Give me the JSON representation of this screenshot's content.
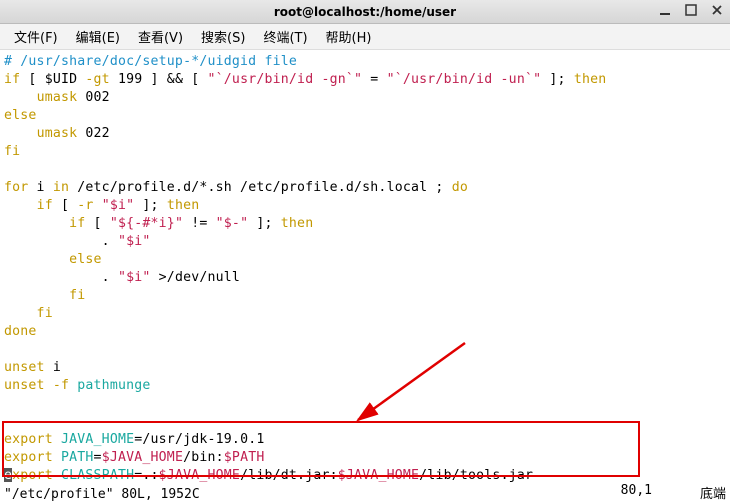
{
  "window": {
    "title": "root@localhost:/home/user"
  },
  "menu": {
    "file": "文件(F)",
    "edit": "编辑(E)",
    "view": "查看(V)",
    "search": "搜索(S)",
    "terminal": "终端(T)",
    "help": "帮助(H)"
  },
  "code": {
    "l1": "# /usr/share/doc/setup-*/uidgid file",
    "l2a": "if",
    "l2b": " [ $UID ",
    "l2c": "-gt",
    "l2d": " 199 ] && [ ",
    "l2e": "\"`/usr/bin/id -gn`\"",
    "l2f": " = ",
    "l2g": "\"`/usr/bin/id -un`\"",
    "l2h": " ]; ",
    "l2i": "then",
    "l3a": "    ",
    "l3b": "umask",
    "l3c": " 002",
    "l4": "else",
    "l5a": "    ",
    "l5b": "umask",
    "l5c": " 022",
    "l6": "fi",
    "l8a": "for",
    "l8b": " i ",
    "l8c": "in",
    "l8d": " /etc/profile.d/*.sh /etc/profile.d/sh.local ; ",
    "l8e": "do",
    "l9a": "    ",
    "l9b": "if",
    "l9c": " [ ",
    "l9d": "-r",
    "l9e": " ",
    "l9f": "\"$i\"",
    "l9g": " ]; ",
    "l9h": "then",
    "l10a": "        ",
    "l10b": "if",
    "l10c": " [ ",
    "l10d": "\"${-#*i}\"",
    "l10e": " != ",
    "l10f": "\"$-\"",
    "l10g": " ]; ",
    "l10h": "then",
    "l11a": "            . ",
    "l11b": "\"$i\"",
    "l12": "        else",
    "l13a": "            . ",
    "l13b": "\"$i\"",
    "l13c": " >/dev/null",
    "l14": "        fi",
    "l15": "    fi",
    "l16": "done",
    "l18a": "unset",
    "l18b": " i",
    "l19a": "unset",
    "l19b": " ",
    "l19c": "-f",
    "l19d": " pathmunge",
    "l21a": "export",
    "l21b": " ",
    "l21c": "JAVA_HOME",
    "l21d": "=/usr/jdk-19.0.1",
    "l22a": "export",
    "l22b": " ",
    "l22c": "PATH",
    "l22d": "=",
    "l22e": "$JAVA_HOME",
    "l22f": "/bin:",
    "l22g": "$PATH",
    "l23cur": "e",
    "l23a": "xport",
    "l23b": " ",
    "l23c": "CLASSPATH",
    "l23d": "=.:",
    "l23e": "$JAVA_HOME",
    "l23f": "/lib/dt.jar:",
    "l23g": "$JAVA_HOME",
    "l23h": "/lib/tools.jar"
  },
  "status": {
    "left": "\"/etc/profile\" 80L, 1952C",
    "pos": "80,1",
    "loc": "底端"
  }
}
